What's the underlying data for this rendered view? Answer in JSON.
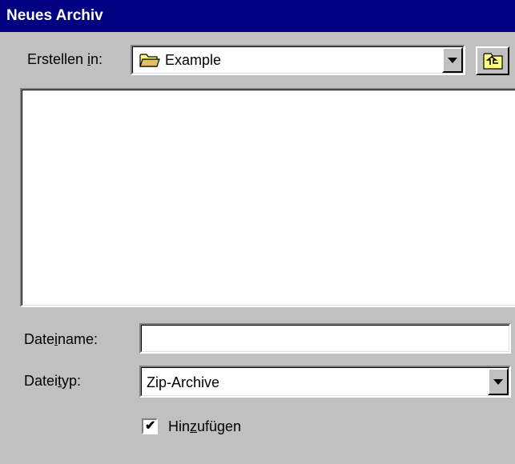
{
  "window": {
    "title": "Neues Archiv"
  },
  "location": {
    "label": "Erstellen in:",
    "label_access_key": "i",
    "value": "Example",
    "icon": "folder-icon",
    "up_button_icon": "up-one-level-icon"
  },
  "file_list": {
    "items": []
  },
  "filename": {
    "label": "Dateiname:",
    "label_access_key": "n",
    "value": ""
  },
  "filetype": {
    "label": "Dateityp:",
    "label_access_key": "t",
    "value": "Zip-Archive"
  },
  "add_option": {
    "label": "Hinzufügen",
    "label_access_key": "z",
    "checked": true
  },
  "colors": {
    "titlebar": "#000080",
    "face": "#c0c0c0"
  }
}
